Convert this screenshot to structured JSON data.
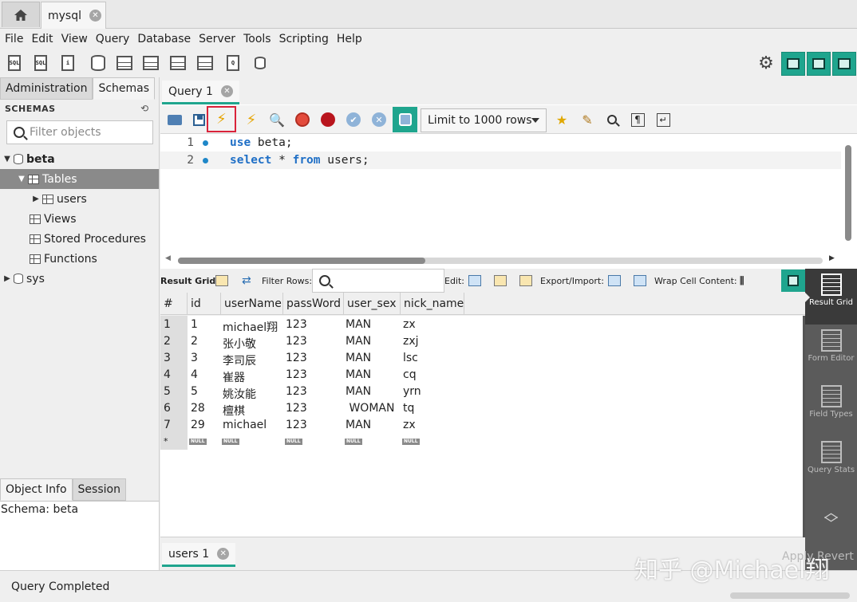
{
  "app": {
    "connection_tab": "mysql"
  },
  "menu": [
    "File",
    "Edit",
    "View",
    "Query",
    "Database",
    "Server",
    "Tools",
    "Scripting",
    "Help"
  ],
  "sidebar": {
    "tabs": [
      "Administration",
      "Schemas"
    ],
    "header": "SCHEMAS",
    "filter_placeholder": "Filter objects",
    "tree": {
      "beta": "beta",
      "tables": "Tables",
      "users": "users",
      "views": "Views",
      "procedures": "Stored Procedures",
      "functions": "Functions",
      "sys": "sys"
    },
    "bottom_tabs": [
      "Object Info",
      "Session"
    ],
    "info": "Schema: beta"
  },
  "editor": {
    "tab_label": "Query 1",
    "limit_label": "Limit to 1000 rows",
    "lines": [
      {
        "num": "1",
        "kw1": "use",
        "rest1": " beta;"
      },
      {
        "num": "2",
        "kw1": "select",
        "mid": " * ",
        "kw2": "from",
        "rest2": " users;"
      }
    ]
  },
  "result": {
    "toolbar": {
      "result_grid": "Result Grid",
      "filter_rows": "Filter Rows:",
      "edit": "Edit:",
      "export_import": "Export/Import:",
      "wrap": "Wrap Cell Content:"
    },
    "columns": [
      "#",
      "id",
      "userName",
      "passWord",
      "user_sex",
      "nick_name"
    ],
    "rows": [
      [
        "1",
        "1",
        "michael翔",
        "123",
        "MAN",
        "zx"
      ],
      [
        "2",
        "2",
        "张小敬",
        "123",
        "MAN",
        "zxj"
      ],
      [
        "3",
        "3",
        "李司辰",
        "123",
        "MAN",
        "lsc"
      ],
      [
        "4",
        "4",
        "崔器",
        "123",
        "MAN",
        "cq"
      ],
      [
        "5",
        "5",
        "姚汝能",
        "123",
        "MAN",
        "yrn"
      ],
      [
        "6",
        "28",
        "檀棋",
        "123",
        " WOMAN",
        "tq"
      ],
      [
        "7",
        "29",
        "michael",
        "123",
        "MAN",
        "zx"
      ]
    ],
    "new_row_marker": "*",
    "null_label": "NULL",
    "bottom_tab": "users 1",
    "apply_revert": "Apply  Revert"
  },
  "right_panel": [
    "Result Grid",
    "Form Editor",
    "Field Types",
    "Query Stats"
  ],
  "status": "Query Completed",
  "watermark": "知乎 @Michael翔"
}
